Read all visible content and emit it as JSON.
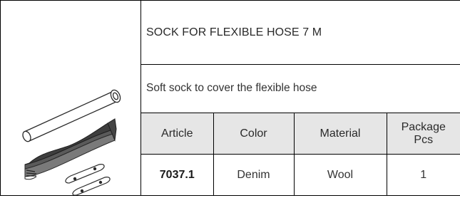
{
  "product": {
    "title": "SOCK FOR FLEXIBLE HOSE 7 M",
    "description": "Soft sock to cover the flexible hose",
    "image_icon": "hose-sock-illustration"
  },
  "specs_table": {
    "headers": [
      "Article",
      "Color",
      "Material",
      "Package Pcs"
    ],
    "header_package_line1": "Package",
    "header_package_line2": "Pcs",
    "rows": [
      {
        "article": "7037.1",
        "color": "Denim",
        "material": "Wool",
        "package_pcs": "1"
      }
    ]
  }
}
